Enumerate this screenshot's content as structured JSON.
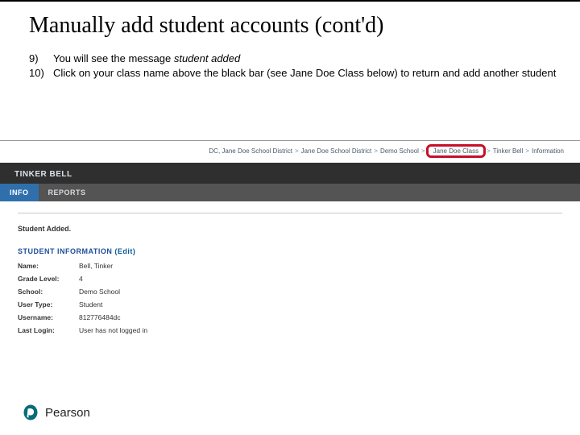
{
  "title": "Manually add student accounts (cont'd)",
  "steps": {
    "s9_num": "9)",
    "s9a": "You will see the message ",
    "s9b_italic": "student added",
    "s10_num": "10)",
    "s10_text": "Click on your class name above the black bar (see Jane Doe Class below) to return and add another student"
  },
  "breadcrumb": {
    "b0": "DC, Jane Doe School District",
    "b1": "Jane Doe School District",
    "b2": "Demo School",
    "b3": "Jane Doe Class",
    "b4": "Tinker Bell",
    "b5": "Information",
    "sep": ">"
  },
  "student_header": "TINKER BELL",
  "tabs": {
    "info": "INFO",
    "reports": "REPORTS"
  },
  "message": "Student Added.",
  "section": {
    "title": "STUDENT INFORMATION",
    "edit": "(Edit)"
  },
  "info": {
    "name_lbl": "Name:",
    "name_val": "Bell, Tinker",
    "grade_lbl": "Grade Level:",
    "grade_val": "4",
    "school_lbl": "School:",
    "school_val": "Demo School",
    "type_lbl": "User Type:",
    "type_val": "Student",
    "user_lbl": "Username:",
    "user_val": "812776484dc",
    "login_lbl": "Last Login:",
    "login_val": "User has not logged in"
  },
  "footer": {
    "brand": "Pearson"
  }
}
